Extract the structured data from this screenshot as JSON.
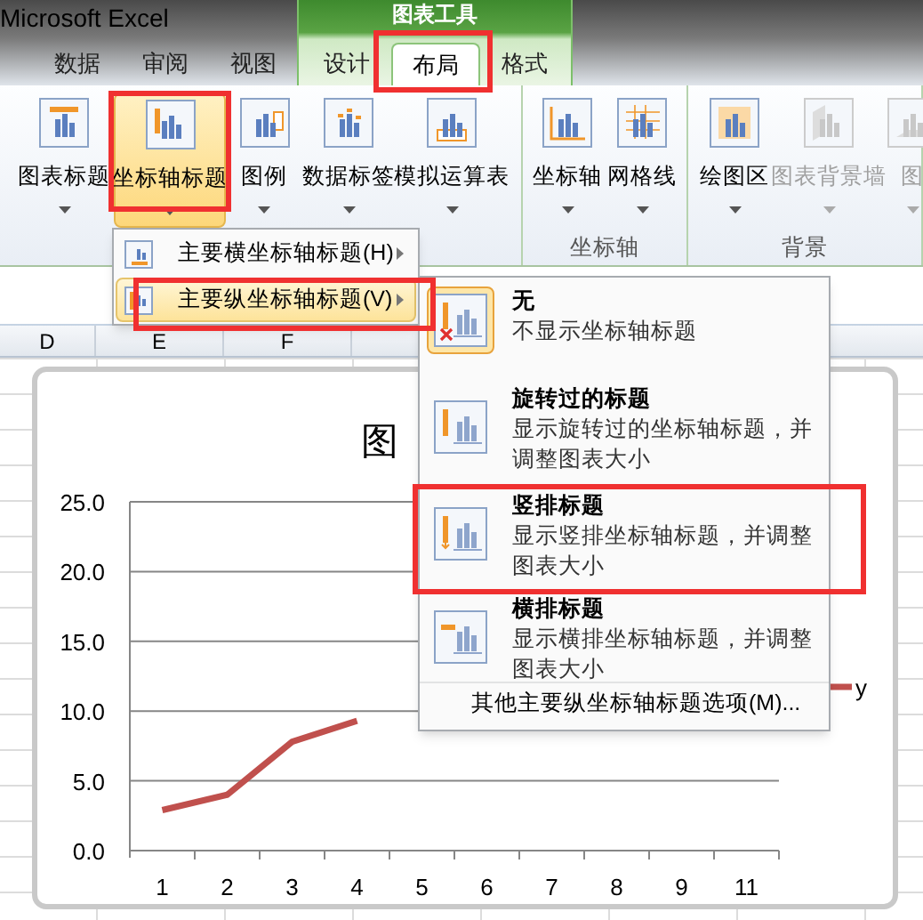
{
  "window": {
    "title": "Microsoft Excel"
  },
  "contextual_group": {
    "title": "图表工具"
  },
  "tabs": [
    {
      "label": "数据",
      "selected": false,
      "contextual": false
    },
    {
      "label": "审阅",
      "selected": false,
      "contextual": false
    },
    {
      "label": "视图",
      "selected": false,
      "contextual": false
    },
    {
      "label": "设计",
      "selected": false,
      "contextual": true
    },
    {
      "label": "布局",
      "selected": true,
      "contextual": true
    },
    {
      "label": "格式",
      "selected": false,
      "contextual": true
    }
  ],
  "ribbon": {
    "groups": [
      {
        "buttons": [
          {
            "label": "图表标题",
            "kind": "chart-title",
            "pressed": false,
            "disabled": false
          },
          {
            "label": "坐标轴标题",
            "kind": "axis-title",
            "pressed": true,
            "disabled": false
          },
          {
            "label": "图例",
            "kind": "legend",
            "pressed": false,
            "disabled": false
          },
          {
            "label": "数据标签",
            "kind": "data-labels",
            "pressed": false,
            "disabled": false
          },
          {
            "label": "模拟运算表",
            "kind": "data-table",
            "pressed": false,
            "disabled": false
          }
        ]
      },
      {
        "label": "坐标轴",
        "buttons": [
          {
            "label": "坐标轴",
            "kind": "axes",
            "pressed": false,
            "disabled": false
          },
          {
            "label": "网格线",
            "kind": "gridlines",
            "pressed": false,
            "disabled": false
          }
        ]
      },
      {
        "label": "背景",
        "buttons": [
          {
            "label": "绘图区",
            "kind": "plot-area",
            "pressed": false,
            "disabled": false
          },
          {
            "label": "图表背景墙",
            "kind": "chart-wall",
            "pressed": false,
            "disabled": true
          },
          {
            "label": "图",
            "kind": "chart-floor",
            "pressed": false,
            "disabled": true
          }
        ]
      }
    ]
  },
  "menu": {
    "items": [
      {
        "label": "主要横坐标轴标题(H)",
        "selected": false,
        "kind": "horizontal"
      },
      {
        "label": "主要纵坐标轴标题(V)",
        "selected": true,
        "kind": "vertical"
      }
    ]
  },
  "submenu": {
    "items": [
      {
        "title": "无",
        "description": "不显示坐标轴标题",
        "selected": true,
        "kind": "none"
      },
      {
        "title": "旋转过的标题",
        "description": "显示旋转过的坐标轴标题，并调整图表大小",
        "selected": false,
        "kind": "rotated"
      },
      {
        "title": "竖排标题",
        "description": "显示竖排坐标轴标题，并调整图表大小",
        "selected": false,
        "kind": "vertical"
      },
      {
        "title": "横排标题",
        "description": "显示横排坐标轴标题，并调整图表大小",
        "selected": false,
        "kind": "horizontal"
      }
    ],
    "footer": "其他主要纵坐标轴标题选项(M)..."
  },
  "sheet": {
    "columns": [
      "D",
      "E",
      "F"
    ]
  },
  "chart": {
    "title": "图",
    "chart_data": {
      "type": "line",
      "grid": true,
      "categories": [
        "1",
        "2",
        "3",
        "4",
        "5",
        "6",
        "7",
        "8",
        "9",
        "11"
      ],
      "series": [
        {
          "name": "y",
          "color": "#c0504d",
          "values": [
            2.9,
            4.0,
            7.8,
            9.3,
            null,
            null,
            null,
            null,
            null,
            null
          ]
        }
      ],
      "ylim": [
        0,
        25
      ],
      "yticks": [
        {
          "value": 0,
          "label": "0.0"
        },
        {
          "value": 5,
          "label": "5.0"
        },
        {
          "value": 10,
          "label": "10.0"
        },
        {
          "value": 15,
          "label": "15.0"
        },
        {
          "value": 20,
          "label": "20.0"
        },
        {
          "value": 25,
          "label": "25.0"
        }
      ]
    }
  }
}
